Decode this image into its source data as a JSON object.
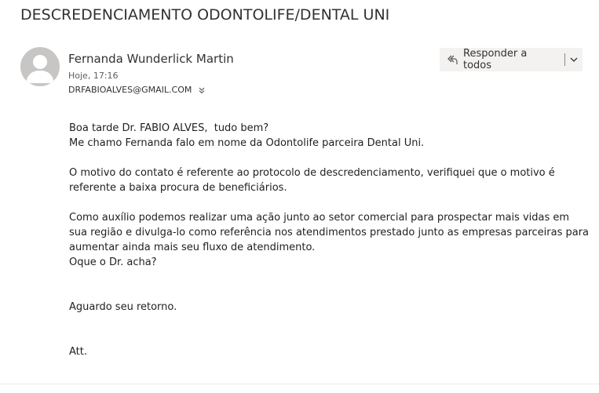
{
  "email": {
    "subject": "DESCREDENCIAMENTO ODONTOLIFE/DENTAL UNI",
    "sender_name": "Fernanda Wunderlick Martin",
    "sent_time": "Hoje, 17:16",
    "recipient": "DRFABIOALVES@GMAIL.COM",
    "reply_all_label": "Responder a todos",
    "body": {
      "line1": "Boa tarde Dr. FABIO ALVES,  tudo bem?",
      "line2": "Me chamo Fernanda falo em nome da Odontolife parceira Dental Uni.",
      "line3": "O motivo do contato é referente ao protocolo de descredenciamento, verifiquei que o motivo é",
      "line4": "referente a baixa procura de beneficiários.",
      "line5": "Como auxílio podemos realizar uma ação junto ao setor comercial para prospectar mais vidas em",
      "line6": "sua região e divulga-lo como referência nos atendimentos prestado junto as empresas parceiras para",
      "line7": "aumentar ainda mais seu fluxo de atendimento.",
      "line8": "Oque o Dr. acha?",
      "line9": "Aguardo seu retorno.",
      "line10": "Att."
    }
  },
  "icons": {
    "avatar": "person-silhouette",
    "reply_all": "reply-all-icon",
    "reply_more": "chevron-down-icon",
    "recipients_expand": "double-chevron-down-icon"
  }
}
